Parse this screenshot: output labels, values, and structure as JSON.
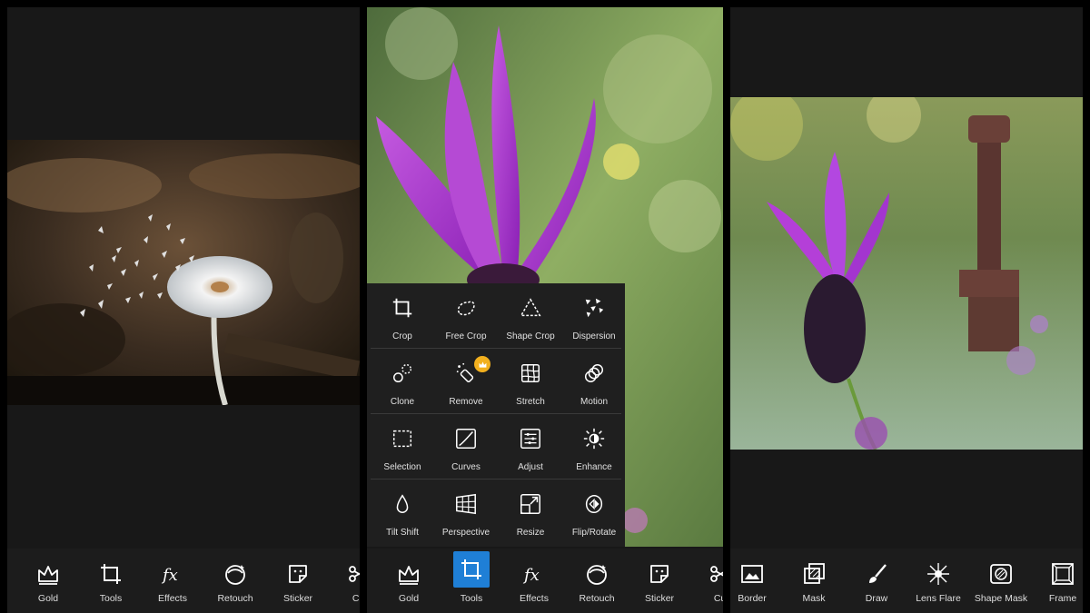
{
  "left_panel": {
    "toolbar": [
      {
        "label": "Gold",
        "icon": "crown-icon"
      },
      {
        "label": "Tools",
        "icon": "crop-icon"
      },
      {
        "label": "Effects",
        "icon": "fx-icon"
      },
      {
        "label": "Retouch",
        "icon": "face-icon"
      },
      {
        "label": "Sticker",
        "icon": "sticker-icon"
      },
      {
        "label": "Cut",
        "icon": "scissors-icon"
      }
    ]
  },
  "middle_panel": {
    "tools_menu": [
      [
        {
          "label": "Crop",
          "icon": "crop-icon"
        },
        {
          "label": "Free Crop",
          "icon": "free-crop-icon"
        },
        {
          "label": "Shape Crop",
          "icon": "triangle-icon"
        },
        {
          "label": "Dispersion",
          "icon": "dispersion-icon"
        }
      ],
      [
        {
          "label": "Clone",
          "icon": "clone-icon"
        },
        {
          "label": "Remove",
          "icon": "remove-icon",
          "premium": true
        },
        {
          "label": "Stretch",
          "icon": "stretch-icon"
        },
        {
          "label": "Motion",
          "icon": "motion-icon"
        }
      ],
      [
        {
          "label": "Selection",
          "icon": "selection-icon"
        },
        {
          "label": "Curves",
          "icon": "curves-icon"
        },
        {
          "label": "Adjust",
          "icon": "adjust-icon"
        },
        {
          "label": "Enhance",
          "icon": "enhance-icon"
        }
      ],
      [
        {
          "label": "Tilt Shift",
          "icon": "drop-icon"
        },
        {
          "label": "Perspective",
          "icon": "perspective-icon"
        },
        {
          "label": "Resize",
          "icon": "resize-icon"
        },
        {
          "label": "Flip/Rotate",
          "icon": "flip-rotate-icon"
        }
      ]
    ],
    "toolbar": [
      {
        "label": "Gold",
        "icon": "crown-icon"
      },
      {
        "label": "Tools",
        "icon": "crop-icon",
        "active": true
      },
      {
        "label": "Effects",
        "icon": "fx-icon"
      },
      {
        "label": "Retouch",
        "icon": "face-icon"
      },
      {
        "label": "Sticker",
        "icon": "sticker-icon"
      },
      {
        "label": "Cut",
        "icon": "scissors-icon"
      }
    ]
  },
  "right_panel": {
    "toolbar": [
      {
        "label": "Border",
        "icon": "border-icon"
      },
      {
        "label": "Mask",
        "icon": "mask-icon"
      },
      {
        "label": "Draw",
        "icon": "brush-icon"
      },
      {
        "label": "Lens Flare",
        "icon": "lens-flare-icon"
      },
      {
        "label": "Shape Mask",
        "icon": "shape-mask-icon"
      },
      {
        "label": "Frame",
        "icon": "frame-icon"
      }
    ]
  },
  "colors": {
    "accent": "#1f7fd6",
    "premium_badge": "#f2b01e",
    "panel_bg": "#181818",
    "menu_bg": "#1f1f1f"
  }
}
